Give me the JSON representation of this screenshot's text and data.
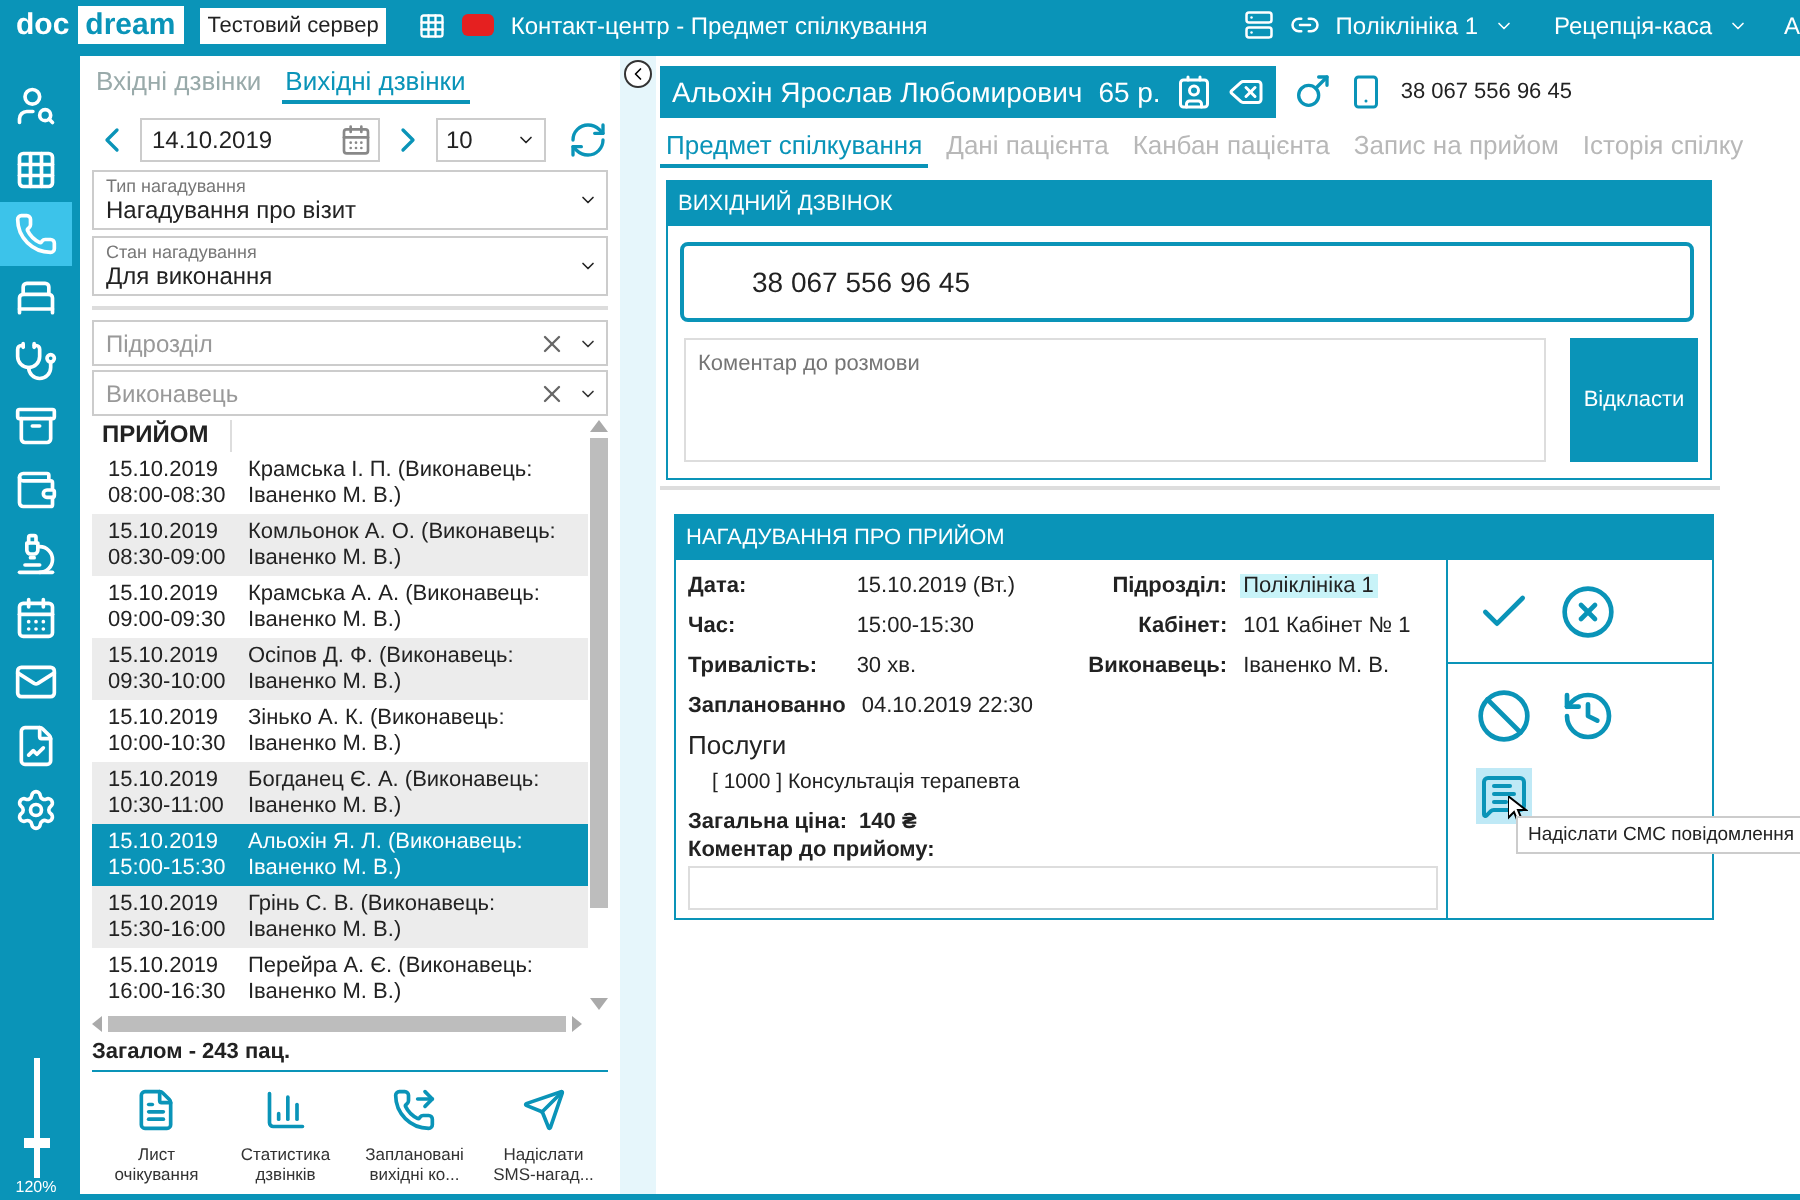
{
  "top_bar": {
    "logo_left": "doc",
    "logo_right": "dream",
    "server_badge": "Тестовий сервер",
    "title": "Контакт-центр - Предмет спілкування",
    "clinic": "Поліклініка 1",
    "desk": "Рецепція-каса",
    "user": "А"
  },
  "sidebar": {
    "items": [
      {
        "selected": false
      },
      {
        "selected": false
      },
      {
        "selected": true
      },
      {
        "selected": false
      },
      {
        "selected": false
      },
      {
        "selected": false
      },
      {
        "selected": false
      },
      {
        "selected": false
      },
      {
        "selected": false
      },
      {
        "selected": false
      },
      {
        "selected": false
      },
      {
        "selected": false
      }
    ],
    "zoom": {
      "level": 0.3,
      "reading": "120%"
    }
  },
  "left_panel": {
    "tabs": [
      {
        "label": "Вхідні дзвінки",
        "selected": false
      },
      {
        "label": "Вихідні дзвінки",
        "selected": true
      }
    ],
    "date": "14.10.2019",
    "count": "10",
    "type_field": {
      "label": "Тип нагадування",
      "value": "Нагадування про візит"
    },
    "state_field": {
      "label": "Стан нагадування",
      "value": "Для виконання"
    },
    "filters": [
      {
        "placeholder": "Підрозділ"
      },
      {
        "placeholder": "Виконавець"
      }
    ],
    "list_header": "ПРИЙОМ",
    "rows": [
      {
        "date": "15.10.2019",
        "time": "08:00-08:30",
        "name": "Крамська І. П. (Виконавець: Іваненко М. В.)",
        "selected": false
      },
      {
        "date": "15.10.2019",
        "time": "08:30-09:00",
        "name": "Комльонок А. О. (Виконавець: Іваненко М. В.)",
        "selected": false
      },
      {
        "date": "15.10.2019",
        "time": "09:00-09:30",
        "name": "Крамська А. А. (Виконавець: Іваненко М. В.)",
        "selected": false
      },
      {
        "date": "15.10.2019",
        "time": "09:30-10:00",
        "name": "Осіпов Д. Ф. (Виконавець: Іваненко М. В.)",
        "selected": false
      },
      {
        "date": "15.10.2019",
        "time": "10:00-10:30",
        "name": "Зінько А. К. (Виконавець: Іваненко М. В.)",
        "selected": false
      },
      {
        "date": "15.10.2019",
        "time": "10:30-11:00",
        "name": "Богданец Є. А. (Виконавець: Іваненко М. В.)",
        "selected": false
      },
      {
        "date": "15.10.2019",
        "time": "15:00-15:30",
        "name": "Альохін Я. Л. (Виконавець: Іваненко М. В.)",
        "selected": true
      },
      {
        "date": "15.10.2019",
        "time": "15:30-16:00",
        "name": "Грінь С. В. (Виконавець: Іваненко М. В.)",
        "selected": false
      },
      {
        "date": "15.10.2019",
        "time": "16:00-16:30",
        "name": "Перейра А. Є. (Виконавець: Іваненко М. В.)",
        "selected": false
      }
    ],
    "total": "Загалом - 243 пац.",
    "actions": [
      {
        "label": "Лист очікування"
      },
      {
        "label": "Статистика дзвінків"
      },
      {
        "label": "Заплановані вихідні ко..."
      },
      {
        "label": "Надіслати SMS-нагад..."
      }
    ]
  },
  "patient": {
    "name": "Альохін Ярослав Любомирович",
    "age": "65 р.",
    "phone": "38 067 556 96 45"
  },
  "tabs": [
    {
      "label": "Предмет спілкування",
      "selected": true
    },
    {
      "label": "Дані пацієнта",
      "selected": false
    },
    {
      "label": "Канбан пацієнта",
      "selected": false
    },
    {
      "label": "Запис на прийом",
      "selected": false
    },
    {
      "label": "Історія спілку",
      "selected": false
    }
  ],
  "call_card": {
    "title": "ВИХІДНИЙ ДЗВІНОК",
    "phone": "38 067 556 96 45",
    "comment_placeholder": "Коментар до розмови",
    "postpone_button": "Відкласти"
  },
  "reminder_card": {
    "title": "НАГАДУВАННЯ ПРО ПРИЙОМ",
    "fields": [
      {
        "label": "Дата:",
        "value": "15.10.2019 (Вт.)"
      },
      {
        "label": "Підрозділ:",
        "value": "Поліклініка 1",
        "highlight": true
      },
      {
        "label": "Час:",
        "value": "15:00-15:30"
      },
      {
        "label": "Кабінет:",
        "value": "101 Кабінет № 1"
      },
      {
        "label": "Тривалість:",
        "value": "30 хв."
      },
      {
        "label": "Виконавець:",
        "value": "Іваненко М. В."
      }
    ],
    "planned_label": "Запланованно",
    "planned_value": "04.10.2019 22:30",
    "services_title": "Послуги",
    "service": "[ 1000 ] Консультація терапевта",
    "price_label": "Загальна ціна:",
    "price_value": "140 ₴",
    "comment_label": "Коментар до прийому:",
    "tooltip": "Надіслати СМС повідомлення"
  }
}
